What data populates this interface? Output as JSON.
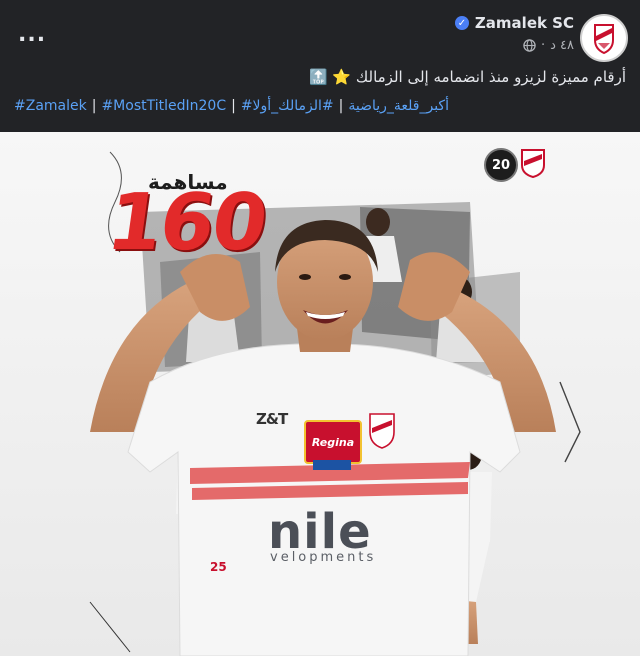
{
  "post": {
    "page_name": "Zamalek SC",
    "time": "٤٨ د",
    "dot": "·",
    "caption": "أرقام مميزة لزيزو منذ انضمامه إلى الزمالك ⭐ 🔝",
    "hashtags": [
      "#Zamalek",
      "#MostTitledIn20C",
      "#أكبر_قلعة_رياضية",
      "#الزمالك_أولا"
    ],
    "hashtag_separator": "|",
    "more_label": "..."
  },
  "poster": {
    "stat_label": "مساهمة",
    "stat_value": "160",
    "badge_number": "20",
    "jersey_brand": "Z&T",
    "sponsor_name": "Regina",
    "shirt_sponsor_main": "nile",
    "shirt_sponsor_sub": "velopments",
    "player_number": "25"
  },
  "colors": {
    "header_bg": "#222326",
    "link": "#5aa1f5",
    "verified": "#4b7ff6",
    "accent_red": "#e22a2a"
  },
  "icons": [
    "more-icon",
    "verified-icon",
    "globe-icon",
    "avatar-zamalek-crest",
    "badge-20-icon",
    "zamalek-crest-icon"
  ]
}
